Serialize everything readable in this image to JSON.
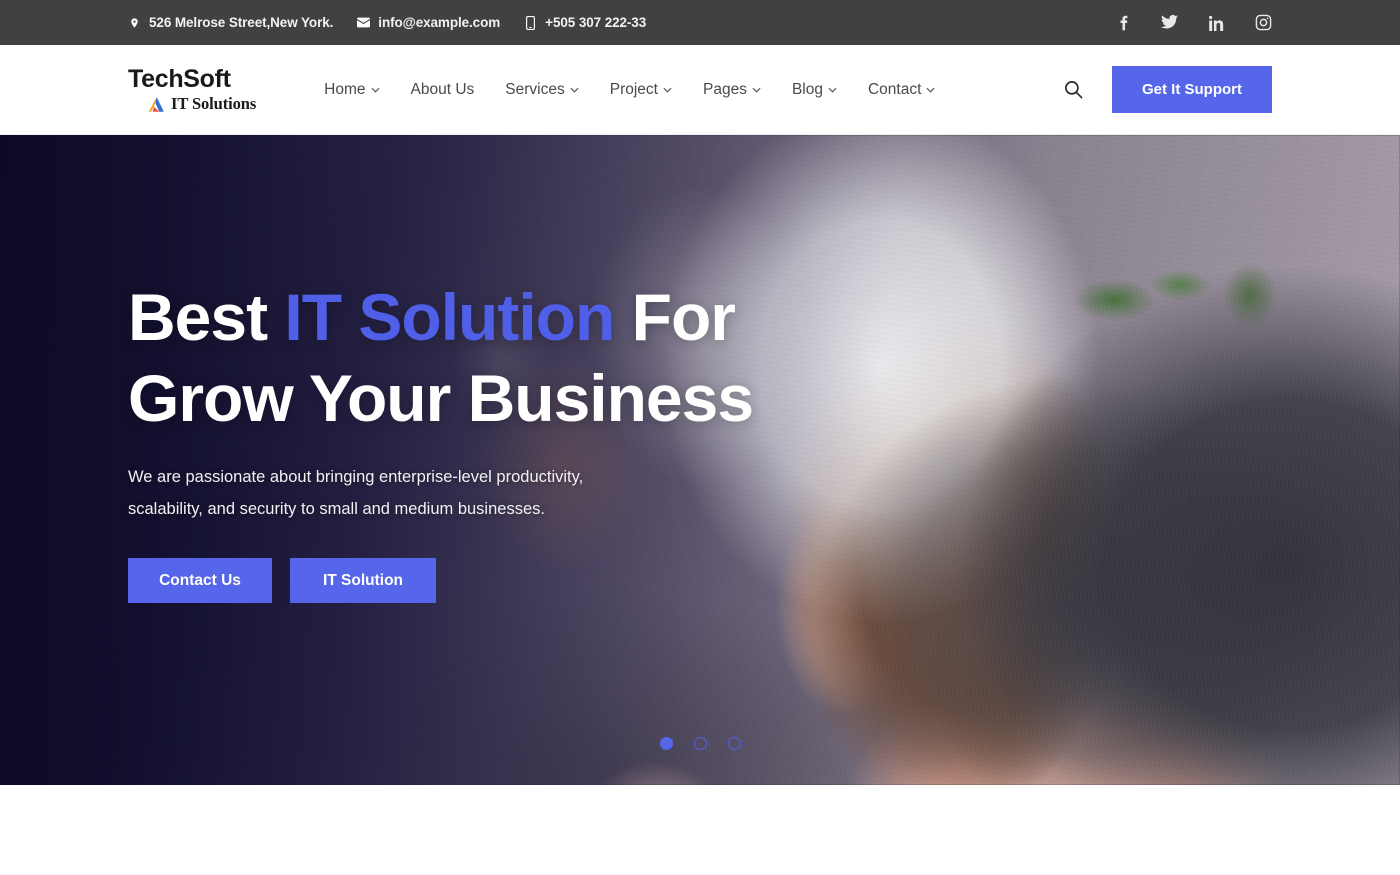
{
  "topbar": {
    "address": "526 Melrose Street,New York.",
    "email": "info@example.com",
    "phone": "+505 307 222-33",
    "address_icon": "location-pin-icon",
    "email_icon": "envelope-icon",
    "phone_icon": "mobile-phone-icon",
    "background": "#414141",
    "socials": [
      {
        "name": "facebook",
        "label": "Facebook"
      },
      {
        "name": "twitter",
        "label": "Twitter"
      },
      {
        "name": "linkedin",
        "label": "LinkedIn"
      },
      {
        "name": "instagram",
        "label": "Instagram"
      }
    ]
  },
  "header": {
    "logo_top": "TechSoft",
    "logo_sub": "IT Solutions",
    "logo_mark_icon": "triangle-arrow-logo-icon",
    "nav": [
      {
        "label": "Home",
        "has_dropdown": true
      },
      {
        "label": "About Us",
        "has_dropdown": false
      },
      {
        "label": "Services",
        "has_dropdown": true
      },
      {
        "label": "Project",
        "has_dropdown": true
      },
      {
        "label": "Pages",
        "has_dropdown": true
      },
      {
        "label": "Blog",
        "has_dropdown": true
      },
      {
        "label": "Contact",
        "has_dropdown": true
      }
    ],
    "search_icon": "search-icon",
    "cta_label": "Get It Support",
    "cta_color": "#5566ea"
  },
  "hero": {
    "title_part1": "Best ",
    "title_accent": "IT Solution",
    "title_part2": " For",
    "title_line2": "Grow Your Business",
    "paragraph": "We are passionate about bringing enterprise-level productivity, scalability, and security to small and medium businesses.",
    "button_primary": "Contact Us",
    "button_secondary": "IT Solution",
    "accent_color": "#4f5fe8",
    "slider": {
      "total": 3,
      "active_index": 0
    }
  }
}
